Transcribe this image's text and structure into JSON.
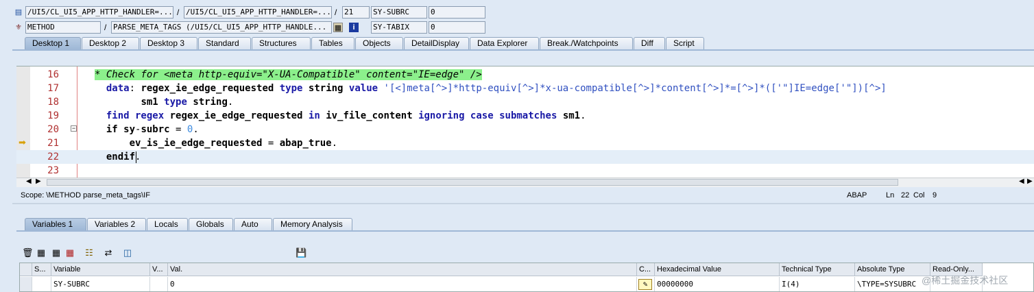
{
  "header": {
    "row1": {
      "program": "/UI5/CL_UI5_APP_HTTP_HANDLER=...",
      "include": "/UI5/CL_UI5_APP_HTTP_HANDLER=...",
      "line": "21",
      "sysvar_name": "SY-SUBRC",
      "sysvar_value": "0"
    },
    "row2": {
      "type": "METHOD",
      "name": "PARSE_META_TAGS (/UI5/CL_UI5_APP_HTTP_HANDLE...",
      "sysvar_name": "SY-TABIX",
      "sysvar_value": "0"
    },
    "sep": "/"
  },
  "desktop_tabs": [
    "Desktop 1",
    "Desktop 2",
    "Desktop 3",
    "Standard",
    "Structures",
    "Tables",
    "Objects",
    "DetailDisplay",
    "Data Explorer",
    "Break./Watchpoints",
    "Diff",
    "Script"
  ],
  "code": {
    "lines": [
      {
        "no": "16",
        "html": "<span class=\"cmt\">* Check for &lt;meta http-equiv=\"X-UA-Compatible\" content=\"IE=edge\" /&gt;</span>"
      },
      {
        "no": "17",
        "html": "  <span class=\"kw\">data</span>: <span class=\"var\">regex_ie_edge_requested</span> <span class=\"kw\">type</span> <span class=\"var\">string</span> <span class=\"kw\">value</span> <span class=\"str\">'[&lt;]meta[^&gt;]*http-equiv[^&gt;]*x-ua-compatible[^&gt;]*content[^&gt;]*=[^&gt;]*(['\"]IE=edge['\"])[^&gt;]</span>"
      },
      {
        "no": "18",
        "html": "        <span class=\"var\">sm1</span> <span class=\"kw\">type</span> <span class=\"var\">string</span>."
      },
      {
        "no": "19",
        "html": "  <span class=\"kw\">find regex</span> <span class=\"var\">regex_ie_edge_requested</span> <span class=\"kw\">in</span> <span class=\"var\">iv_file_content</span> <span class=\"kw\">ignoring case submatches</span> <span class=\"var\">sm1</span>."
      },
      {
        "no": "20",
        "html": "  <span class=\"var\">if sy</span>-<span class=\"var\">subrc</span> = <span class=\"num\">0</span>."
      },
      {
        "no": "21",
        "html": "      <span class=\"var\">ev_is_ie_edge_requested</span> = <span class=\"var\">abap_true</span>."
      },
      {
        "no": "22",
        "html": "  <span class=\"var\">endif</span>."
      },
      {
        "no": "23",
        "html": ""
      }
    ]
  },
  "status": {
    "scope": "Scope: \\METHOD parse_meta_tags\\IF",
    "lang": "ABAP",
    "ln_label": "Ln",
    "ln": "22",
    "col_label": "Col",
    "col": "9"
  },
  "var_tabs": [
    "Variables 1",
    "Variables 2",
    "Locals",
    "Globals",
    "Auto",
    "Memory Analysis"
  ],
  "grid": {
    "headers": [
      "S...",
      "Variable",
      "V...",
      "Val.",
      "C...",
      "Hexadecimal Value",
      "Technical Type",
      "Absolute Type",
      "Read-Only..."
    ],
    "row": {
      "variable": "SY-SUBRC",
      "value": "0",
      "hex": "00000000",
      "tech": "I(4)",
      "abs": "\\TYPE=SYSUBRC"
    }
  },
  "watermark": "@稀土掘金技术社区",
  "colors": {
    "accent": "#1a1aa6",
    "comment_bg": "#8cf08c",
    "current_line": "#e4eef8"
  }
}
